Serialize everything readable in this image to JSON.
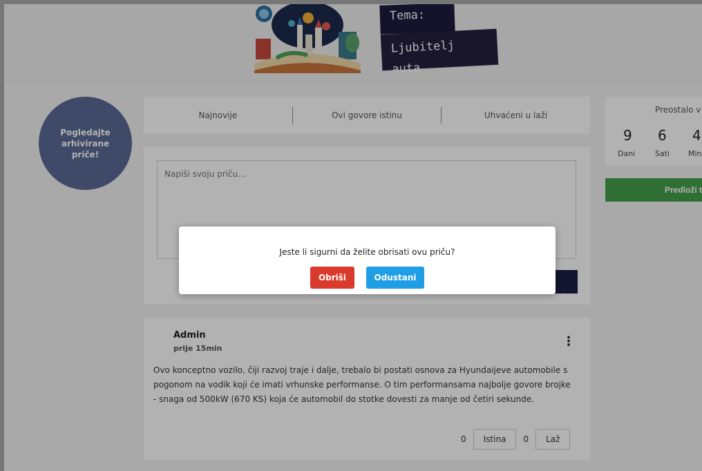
{
  "banner": {
    "tag_theme": "Tema:",
    "tag_topic": "Ljubitelj auta"
  },
  "archive": {
    "label": "Pogledajte arhivirane priče!"
  },
  "tabs": [
    {
      "label": "Najnovije"
    },
    {
      "label": "Ovi govore istinu"
    },
    {
      "label": "Uhvaćeni u laži"
    }
  ],
  "compose": {
    "placeholder": "Napiši svoju priču..."
  },
  "timer": {
    "title": "Preostalo v",
    "days": "9",
    "days_label": "Dani",
    "hours": "6",
    "hours_label": "Sati",
    "minutes": "4",
    "minutes_label": "Min"
  },
  "suggest": {
    "label": "Predloži t"
  },
  "story": {
    "author": "Admin",
    "time": "prije 15min",
    "text": "Ovo konceptno vozilo, čiji razvoj traje i dalje, trebalo bi postati osnova za Hyundaijeve automobile s pogonom na vodik koji će imati vrhunske performanse. O tim performansama najbolje govore brojke - snaga od 500kW (670 KS) koja će automobil do stotke dovesti za manje od četiri sekunde.",
    "truth_count": "0",
    "truth_label": "Istina",
    "lie_count": "0",
    "lie_label": "Laž",
    "menu_icon": "⋮"
  },
  "modal": {
    "message": "Jeste li sigurni da želite obrisati ovu priču?",
    "delete_label": "Obriši",
    "cancel_label": "Odustani"
  },
  "colors": {
    "archive_circle": "#5a6b95",
    "delete": "#d93a2b",
    "cancel": "#1f9ee6",
    "suggest": "#45a049"
  }
}
